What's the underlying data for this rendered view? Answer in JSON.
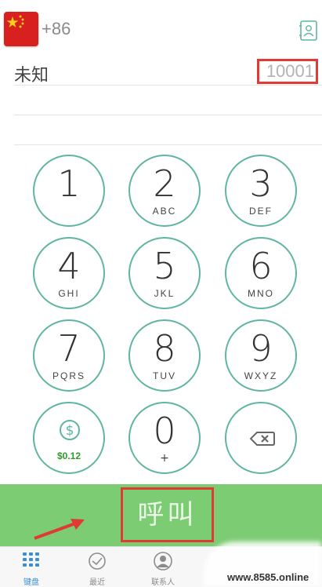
{
  "header": {
    "country_code": "+86",
    "flag_icon": "china-flag-icon",
    "contacts_icon": "address-book-icon"
  },
  "caller": {
    "name": "未知",
    "number": "10001"
  },
  "keypad": [
    {
      "digit": "1",
      "letters": ""
    },
    {
      "digit": "2",
      "letters": "ABC"
    },
    {
      "digit": "3",
      "letters": "DEF"
    },
    {
      "digit": "4",
      "letters": "GHI"
    },
    {
      "digit": "5",
      "letters": "JKL"
    },
    {
      "digit": "6",
      "letters": "MNO"
    },
    {
      "digit": "7",
      "letters": "PQRS"
    },
    {
      "digit": "8",
      "letters": "TUV"
    },
    {
      "digit": "9",
      "letters": "WXYZ"
    }
  ],
  "bottom_keys": {
    "balance": "$0.12",
    "balance_icon": "dollar-coin-icon",
    "zero": "0",
    "zero_sub": "+",
    "delete_icon": "backspace-icon"
  },
  "call": {
    "label": "呼叫"
  },
  "tabs": [
    {
      "label": "键盘",
      "icon": "keypad-grid-icon",
      "active": true
    },
    {
      "label": "最近",
      "icon": "clock-history-icon",
      "active": false
    },
    {
      "label": "联系人",
      "icon": "person-icon",
      "active": false
    },
    {
      "label": "",
      "icon": "more-icon",
      "active": false
    }
  ],
  "watermark": "www.8585.online",
  "colors": {
    "key_border": "#5fb5a2",
    "call_bar": "#7ccc74",
    "highlight": "#e03a35",
    "tab_active": "#3a8fd6"
  }
}
